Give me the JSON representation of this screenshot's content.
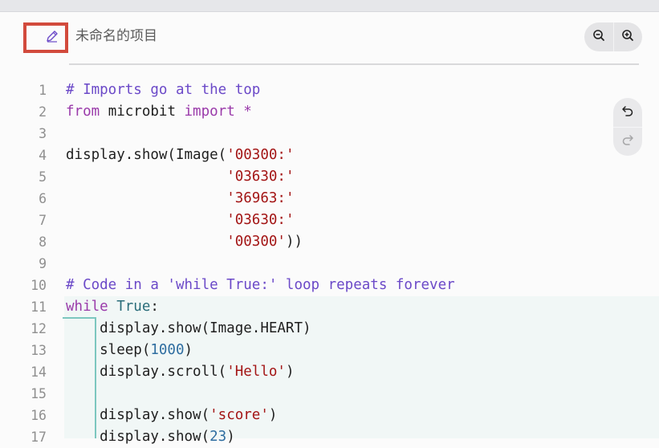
{
  "header": {
    "project_name": "未命名的项目",
    "edit_icon": "pencil-icon",
    "zoom_out_icon": "zoom-out-icon",
    "zoom_in_icon": "zoom-in-icon"
  },
  "editor": {
    "undo_icon": "undo-icon",
    "redo_icon": "redo-icon",
    "lines": [
      {
        "n": "1",
        "parts": [
          {
            "t": "# Imports go at the top",
            "c": "tok-comment"
          }
        ]
      },
      {
        "n": "2",
        "parts": [
          {
            "t": "from",
            "c": "tok-kw"
          },
          {
            "t": " microbit ",
            "c": ""
          },
          {
            "t": "import",
            "c": "tok-kw"
          },
          {
            "t": " *",
            "c": "tok-kw"
          }
        ]
      },
      {
        "n": "3",
        "parts": []
      },
      {
        "n": "4",
        "parts": [
          {
            "t": "display.show(Image(",
            "c": ""
          },
          {
            "t": "'00300:'",
            "c": "tok-str"
          }
        ]
      },
      {
        "n": "5",
        "parts": [
          {
            "t": "                   ",
            "c": ""
          },
          {
            "t": "'03630:'",
            "c": "tok-str"
          }
        ]
      },
      {
        "n": "6",
        "parts": [
          {
            "t": "                   ",
            "c": ""
          },
          {
            "t": "'36963:'",
            "c": "tok-str"
          }
        ]
      },
      {
        "n": "7",
        "parts": [
          {
            "t": "                   ",
            "c": ""
          },
          {
            "t": "'03630:'",
            "c": "tok-str"
          }
        ]
      },
      {
        "n": "8",
        "parts": [
          {
            "t": "                   ",
            "c": ""
          },
          {
            "t": "'00300'",
            "c": "tok-str"
          },
          {
            "t": "))",
            "c": ""
          }
        ]
      },
      {
        "n": "9",
        "parts": []
      },
      {
        "n": "10",
        "parts": [
          {
            "t": "# Code in a 'while True:' loop repeats forever",
            "c": "tok-comment"
          }
        ]
      },
      {
        "n": "11",
        "parts": [
          {
            "t": "while",
            "c": "tok-kw"
          },
          {
            "t": " ",
            "c": ""
          },
          {
            "t": "True",
            "c": "tok-const"
          },
          {
            "t": ":",
            "c": ""
          }
        ]
      },
      {
        "n": "12",
        "parts": [
          {
            "t": "    display.show(Image.HEART)",
            "c": ""
          }
        ]
      },
      {
        "n": "13",
        "parts": [
          {
            "t": "    sleep(",
            "c": ""
          },
          {
            "t": "1000",
            "c": "tok-num"
          },
          {
            "t": ")",
            "c": ""
          }
        ]
      },
      {
        "n": "14",
        "parts": [
          {
            "t": "    display.scroll(",
            "c": ""
          },
          {
            "t": "'Hello'",
            "c": "tok-str"
          },
          {
            "t": ")",
            "c": ""
          }
        ]
      },
      {
        "n": "15",
        "parts": []
      },
      {
        "n": "16",
        "parts": [
          {
            "t": "    display.show(",
            "c": ""
          },
          {
            "t": "'score'",
            "c": "tok-str"
          },
          {
            "t": ")",
            "c": ""
          }
        ]
      },
      {
        "n": "17",
        "parts": [
          {
            "t": "    display.show(",
            "c": ""
          },
          {
            "t": "23",
            "c": "tok-num"
          },
          {
            "t": ")",
            "c": ""
          }
        ]
      }
    ]
  }
}
